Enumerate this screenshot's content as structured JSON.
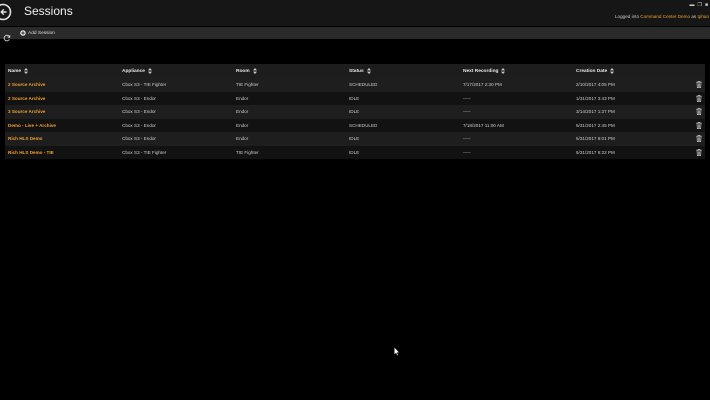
{
  "header": {
    "title": "Sessions",
    "login_prefix": "Logged into",
    "login_org": "Command Center Demo",
    "login_mid": "as",
    "login_user": "tphan"
  },
  "toolbar": {
    "add_session_label": "Add Session"
  },
  "table": {
    "columns": [
      "Name",
      "Appliance",
      "Room",
      "Status",
      "Next Recording",
      "Creation Date"
    ],
    "rows": [
      [
        "2 Source Archive",
        "Cbox S3 - TIE Fighter",
        "TIE Fighter",
        "SCHEDULED",
        "7/17/2017 2:30 PM",
        "2/10/2017 4:05 PM"
      ],
      [
        "2 Source Archive",
        "Cbox S3 - Endor",
        "Endor",
        "IDLE",
        "-----",
        "1/31/2017 3:43 PM"
      ],
      [
        "3 Source Archive",
        "Cbox S3 - Endor",
        "Endor",
        "IDLE",
        "-----",
        "3/14/2017 1:37 PM"
      ],
      [
        "Demo - Live + Archive",
        "Cbox S3 - Endor",
        "Endor",
        "SCHEDULED",
        "7/18/2017 11:00 AM",
        "5/31/2017 2:45 PM"
      ],
      [
        "Rich HLS Demo",
        "Cbox S3 - Endor",
        "Endor",
        "IDLE",
        "-----",
        "5/31/2017 6:01 PM"
      ],
      [
        "Rich HLS Demo - TIE",
        "Cbox S3 - TIE Fighter",
        "TIE Fighter",
        "IDLE",
        "-----",
        "5/31/2017 6:22 PM"
      ]
    ]
  },
  "colors": {
    "accent": "#f0a030",
    "background": "#000000",
    "header_bg": "#161616",
    "toolbar_bg": "#2a2a2a"
  },
  "icons": [
    "back-arrow-icon",
    "refresh-icon",
    "add-circle-icon",
    "sort-icon",
    "trash-icon",
    "minimize-icon",
    "restore-icon",
    "close-icon",
    "mouse-cursor-icon"
  ]
}
